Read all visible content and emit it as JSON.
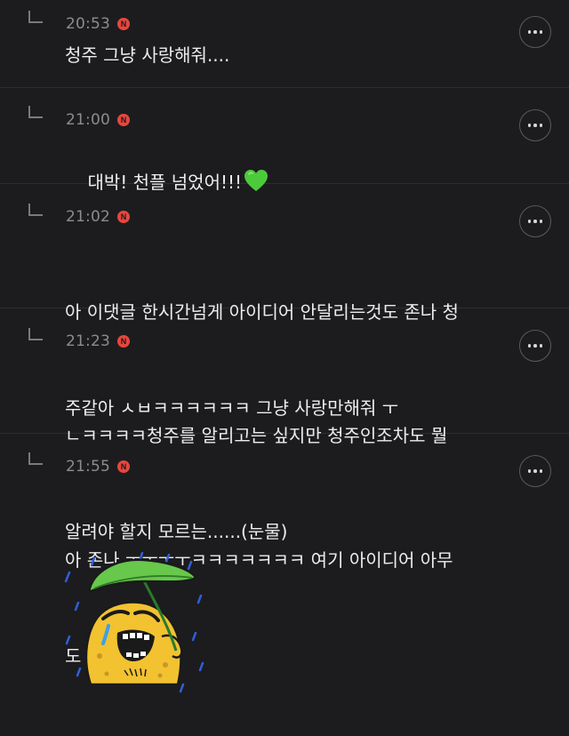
{
  "colors": {
    "background": "#1c1c1e",
    "divider": "#2e2e30",
    "badge": "#e8463c",
    "timestamp": "#8c8c8c",
    "heart": "#4ccb3a"
  },
  "comments": [
    {
      "time": "20:53",
      "badge": "N",
      "text": "청주 그냥 사랑해줘...."
    },
    {
      "time": "21:00",
      "badge": "N",
      "text": "대박! 천플 넘었어!!!",
      "emoji": "green-heart-icon"
    },
    {
      "time": "21:02",
      "badge": "N",
      "line1": "아 이댓글 한시간넘게 아이디어 안달리는것도 존나 청",
      "line2": "주같아 ㅅㅂㅋㅋㅋㅋㅋㅋ 그냥 사랑만해줘 ㅜ"
    },
    {
      "time": "21:23",
      "badge": "N",
      "line1": "ㄴㅋㅋㅋㅋ청주를 알리고는 싶지만 청주인조차도 뭘",
      "line2": "알려야 할지 모르는......(눈물)"
    },
    {
      "time": "21:55",
      "badge": "N",
      "line1": "아 존나 ㅜㅜㅜㅜㅋㅋㅋㅋㅋㅋㅋ 여기 아이디어 아무",
      "line2": "도 읎어요....",
      "sticker": "crying-toad-under-leaf-sticker"
    }
  ]
}
